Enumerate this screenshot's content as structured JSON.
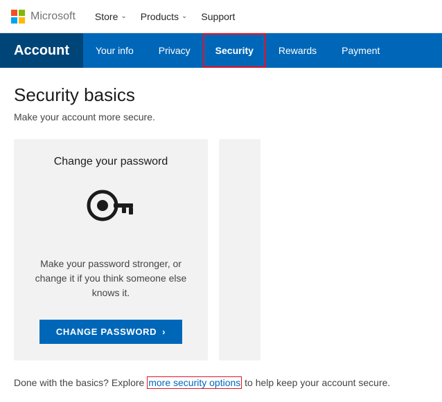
{
  "topnav": {
    "brand": "Microsoft",
    "links": [
      {
        "label": "Store",
        "has_dropdown": true
      },
      {
        "label": "Products",
        "has_dropdown": true
      },
      {
        "label": "Support",
        "has_dropdown": false
      }
    ]
  },
  "accountnav": {
    "title": "Account",
    "items": [
      {
        "label": "Your info",
        "active": false
      },
      {
        "label": "Privacy",
        "active": false
      },
      {
        "label": "Security",
        "active": true
      },
      {
        "label": "Rewards",
        "active": false
      },
      {
        "label": "Payment",
        "active": false
      }
    ]
  },
  "main": {
    "page_title": "Security basics",
    "page_subtitle": "Make your account more secure.",
    "cards": [
      {
        "title": "Change your password",
        "description": "Make your password stronger, or change it if you think someone else knows it.",
        "button_label": "CHANGE PASSWORD",
        "button_icon": "›"
      }
    ],
    "footer_prefix": "Done with the basics? Explore ",
    "footer_link": "more security options",
    "footer_suffix": " to help keep your account secure."
  }
}
